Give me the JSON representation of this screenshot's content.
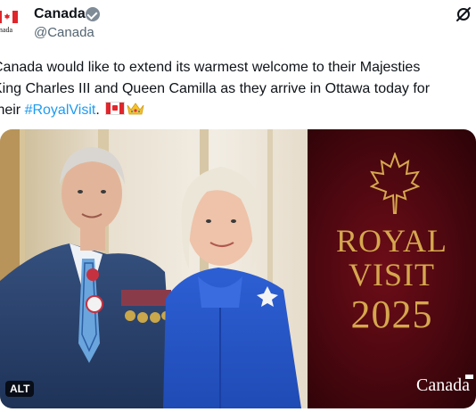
{
  "account": {
    "name": "Canada",
    "handle": "@Canada",
    "avatar_text": "Canada"
  },
  "tweet": {
    "line1": "Canada would like to extend its warmest welcome to their Majesties",
    "line2": "King Charles III and Queen Camilla as they arrive in Ottawa today for",
    "line3_prefix": "their ",
    "hashtag": "#RoyalVisit",
    "line3_suffix": ".",
    "emojis": [
      "canada-flag-emoji",
      "crown-emoji"
    ]
  },
  "media": {
    "alt_badge": "ALT",
    "panel": {
      "line1": "ROYAL",
      "line2": "VISIT",
      "year": "2025",
      "wordmark": "Canada"
    }
  },
  "colors": {
    "link": "#1d9bf0",
    "gold": "#d6a74e",
    "maroon": "#5a0a14",
    "flag_red": "#e0262b"
  },
  "icons": [
    "verified-badge-icon",
    "grok-icon",
    "maple-leaf-icon"
  ]
}
